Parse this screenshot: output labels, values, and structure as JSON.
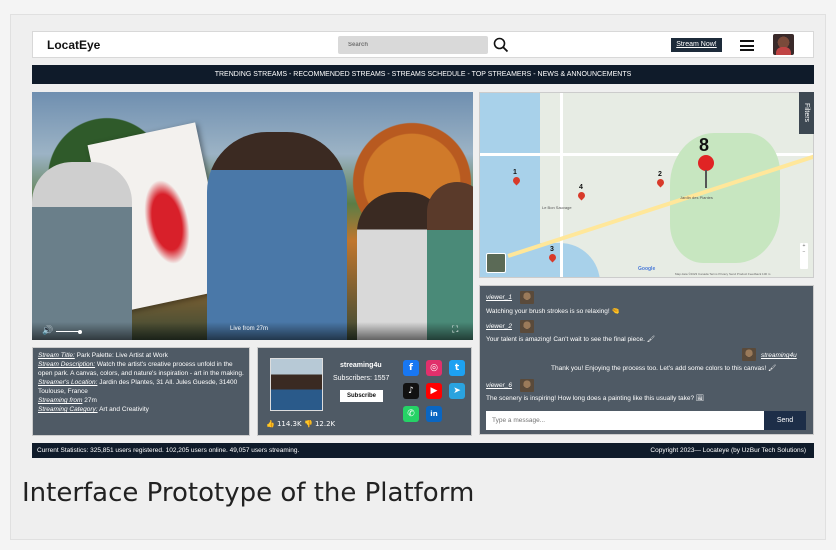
{
  "header": {
    "logo": "LocatEye",
    "search_placeholder": "Search",
    "stream_now_label": "Stream Now!"
  },
  "navbar": {
    "text": "TRENDING STREAMS - RECOMMENDED STREAMS - STREAMS SCHEDULE  - TOP STREAMERS - NEWS & ANNOUNCEMENTS"
  },
  "video": {
    "live_label": "Live from 27m"
  },
  "map": {
    "filters_label": "Filters",
    "google": "Google",
    "footer": "Map data ©2023  Canada  Terms  Privacy  Send Product Feedback  100 m",
    "pins": [
      "1",
      "2",
      "3",
      "4",
      "8"
    ],
    "labels": [
      "Jardin des Plantes",
      "Le Bon Sauvage"
    ]
  },
  "chat": {
    "messages": [
      {
        "user": "viewer_1",
        "text": "Watching your brush strokes is so relaxing! 🤏"
      },
      {
        "user": "viewer_2",
        "text": "Your talent is amazing! Can't wait to see the final piece. 🖌"
      },
      {
        "user": "streaming4u",
        "text": "Thank you! Enjoying the process too. Let's add some colors to this canvas! 🖌"
      },
      {
        "user": "viewer_6",
        "text": "The scenery is inspiring! How long does a painting like this usually take? 🖼"
      }
    ],
    "input_placeholder": "Type a message...",
    "send_label": "Send"
  },
  "info": {
    "title_label": "Stream Title:",
    "title_value": " Park Palette: Live Artist at Work",
    "desc_label": "Stream Description:",
    "desc_value": " Watch the artist's creative process unfold in the open park. A canvas, colors, and nature's inspiration - art in the making.",
    "location_label": "Streamer's Location:",
    "location_value": " Jardin des Plantes, 31 All. Jules Guesde, 31400 Toulouse, France",
    "from_label": "Streaming from",
    "from_value": " 27m",
    "category_label": "Streaming Category:",
    "category_value": " Art and Creativity"
  },
  "streamer": {
    "name": "streaming4u",
    "subscribers": "Subscribers: 1557",
    "subscribe_label": "Subscribe",
    "likes": "114.3K",
    "dislikes": "12.2K"
  },
  "social_icons": [
    {
      "name": "facebook-icon",
      "glyph": "f",
      "color": "#1877f2"
    },
    {
      "name": "instagram-icon",
      "glyph": "◎",
      "color": "#e1306c"
    },
    {
      "name": "twitter-icon",
      "glyph": "t",
      "color": "#1da1f2"
    },
    {
      "name": "tiktok-icon",
      "glyph": "♪",
      "color": "#111111"
    },
    {
      "name": "youtube-icon",
      "glyph": "▶",
      "color": "#ff0000"
    },
    {
      "name": "telegram-icon",
      "glyph": "➤",
      "color": "#2aa3df"
    },
    {
      "name": "whatsapp-icon",
      "glyph": "✆",
      "color": "#25d366"
    },
    {
      "name": "linkedin-icon",
      "glyph": "in",
      "color": "#0a66c2"
    }
  ],
  "footer": {
    "stats": "Current Statistics: 325,851 users registered. 102,205 users online. 49,057 users streaming.",
    "copyright": "Copyright 2023— Locateye (by UzBur Tech Solutions)"
  },
  "caption": "Interface Prototype of the Platform"
}
